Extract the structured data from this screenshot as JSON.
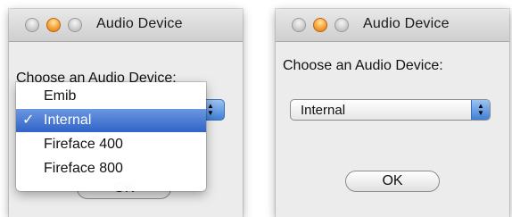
{
  "left_dialog": {
    "window_title": "Audio Device",
    "prompt": "Choose an Audio Device:",
    "menu_items": [
      {
        "label": "Emib",
        "checked": false
      },
      {
        "label": "Internal",
        "checked": true
      },
      {
        "label": "Fireface 400",
        "checked": false
      },
      {
        "label": "Fireface 800",
        "checked": false
      }
    ],
    "check_mark": "✓",
    "ok_label": "OK"
  },
  "right_dialog": {
    "window_title": "Audio Device",
    "prompt": "Choose an Audio Device:",
    "selected_value": "Internal",
    "ok_label": "OK"
  },
  "colors": {
    "menu_highlight": "#2f63c8",
    "popup_arrows": "#3f7fd6",
    "zoom_light": "#f7a640",
    "window_bg": "#ececec"
  }
}
